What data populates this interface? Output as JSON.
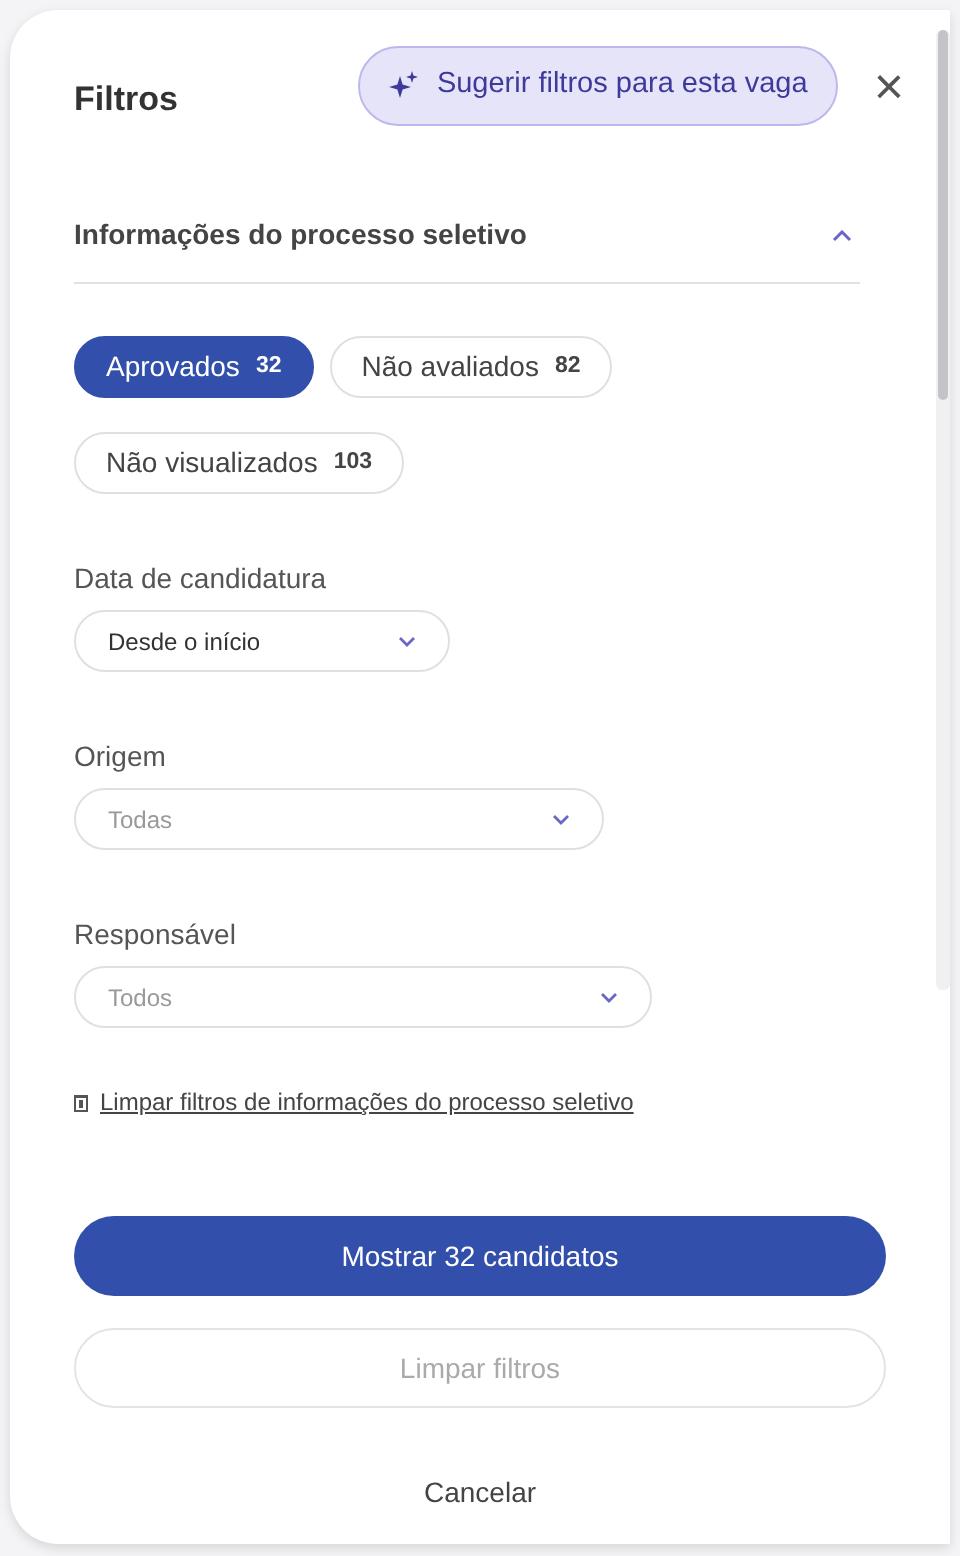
{
  "header": {
    "title": "Filtros",
    "suggest_button": "Sugerir filtros para esta vaga",
    "close": "×"
  },
  "section": {
    "title": "Informações do processo seletivo",
    "expanded": true
  },
  "chips": [
    {
      "label": "Aprovados",
      "count": "32",
      "selected": true
    },
    {
      "label": "Não avaliados",
      "count": "82",
      "selected": false
    },
    {
      "label": "Não visualizados",
      "count": "103",
      "selected": false
    }
  ],
  "selects": [
    {
      "label": "Data de candidatura",
      "value": "Desde o início"
    },
    {
      "label": "Origem",
      "placeholder": "Todas"
    },
    {
      "label": "Responsável",
      "placeholder": "Todos"
    }
  ],
  "clear_section_link": "Limpar filtros de informações do processo seletivo",
  "buttons": [
    {
      "label": "Mostrar 32 candidatos",
      "kind": "primary",
      "disabled": false
    },
    {
      "label": "Limpar filtros",
      "kind": "outline",
      "disabled": true
    },
    {
      "label": "Cancelar",
      "kind": "text",
      "disabled": false
    }
  ]
}
